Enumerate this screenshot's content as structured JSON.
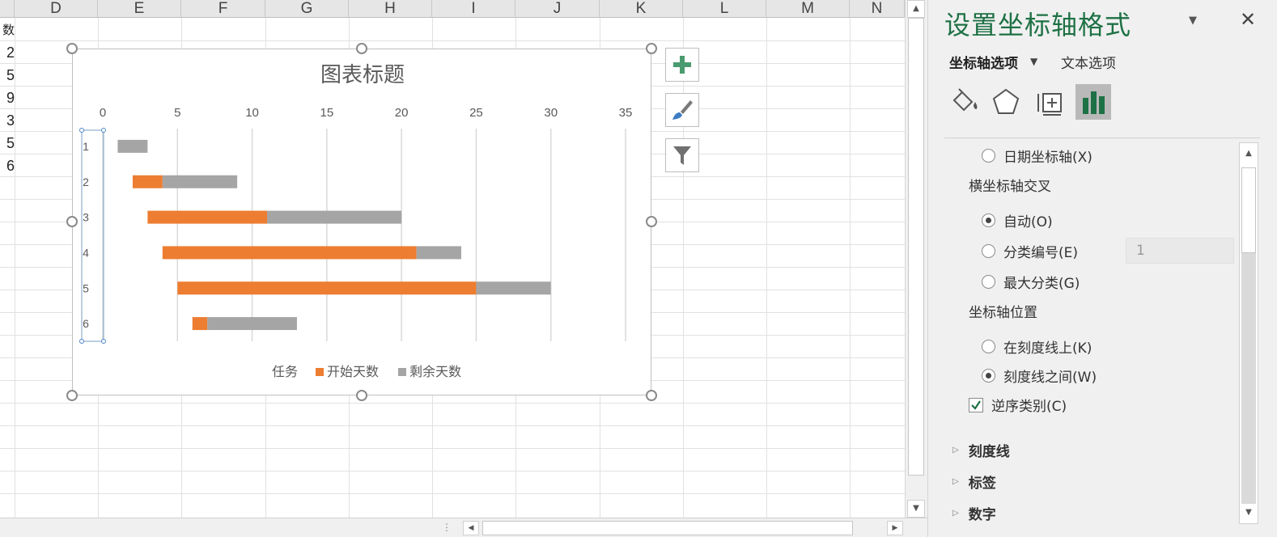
{
  "sheet": {
    "columns": [
      "D",
      "E",
      "F",
      "G",
      "H",
      "I",
      "J",
      "K",
      "L",
      "M",
      "N"
    ],
    "row_fragment_top": "数",
    "row_values": [
      "2",
      "5",
      "9",
      "3",
      "5",
      "6"
    ]
  },
  "chart_data": {
    "type": "bar",
    "orientation": "horizontal",
    "stacked": true,
    "title": "图表标题",
    "categories": [
      "1",
      "2",
      "3",
      "4",
      "5",
      "6"
    ],
    "category_axis_reversed": true,
    "x_axis": {
      "ticks": [
        "0",
        "5",
        "10",
        "15",
        "20",
        "25",
        "30",
        "35"
      ],
      "range": [
        0,
        35
      ],
      "position": "top"
    },
    "gridlines": true,
    "legend_position": "bottom",
    "series": [
      {
        "name": "任务",
        "values": [
          1,
          2,
          3,
          4,
          5,
          6
        ],
        "color": "transparent"
      },
      {
        "name": "开始天数",
        "values": [
          0,
          2,
          8,
          17,
          20,
          1
        ],
        "color": "#ED7D31"
      },
      {
        "name": "剩余天数",
        "values": [
          2,
          5,
          9,
          3,
          5,
          6
        ],
        "color": "#A5A5A5"
      }
    ]
  },
  "chart_buttons": {
    "add_element": "plus-icon",
    "styles": "brush-icon",
    "filter": "filter-icon"
  },
  "pane": {
    "title": "设置坐标轴格式",
    "tabs": {
      "axis_options": "坐标轴选项",
      "text_options": "文本选项"
    },
    "options": {
      "date_axis": "日期坐标轴(X)",
      "horizontal_axis_crosses": "横坐标轴交叉",
      "auto": "自动(O)",
      "category_number": "分类编号(E)",
      "category_number_value": "1",
      "max_category": "最大分类(G)",
      "axis_position": "坐标轴位置",
      "on_tick_marks": "在刻度线上(K)",
      "between_tick_marks": "刻度线之间(W)",
      "reverse_order": "逆序类别(C)"
    },
    "sections": [
      "刻度线",
      "标签",
      "数字"
    ],
    "colors": {
      "accent": "#1E7145",
      "orange": "#ED7D31",
      "gray": "#A5A5A5"
    }
  }
}
